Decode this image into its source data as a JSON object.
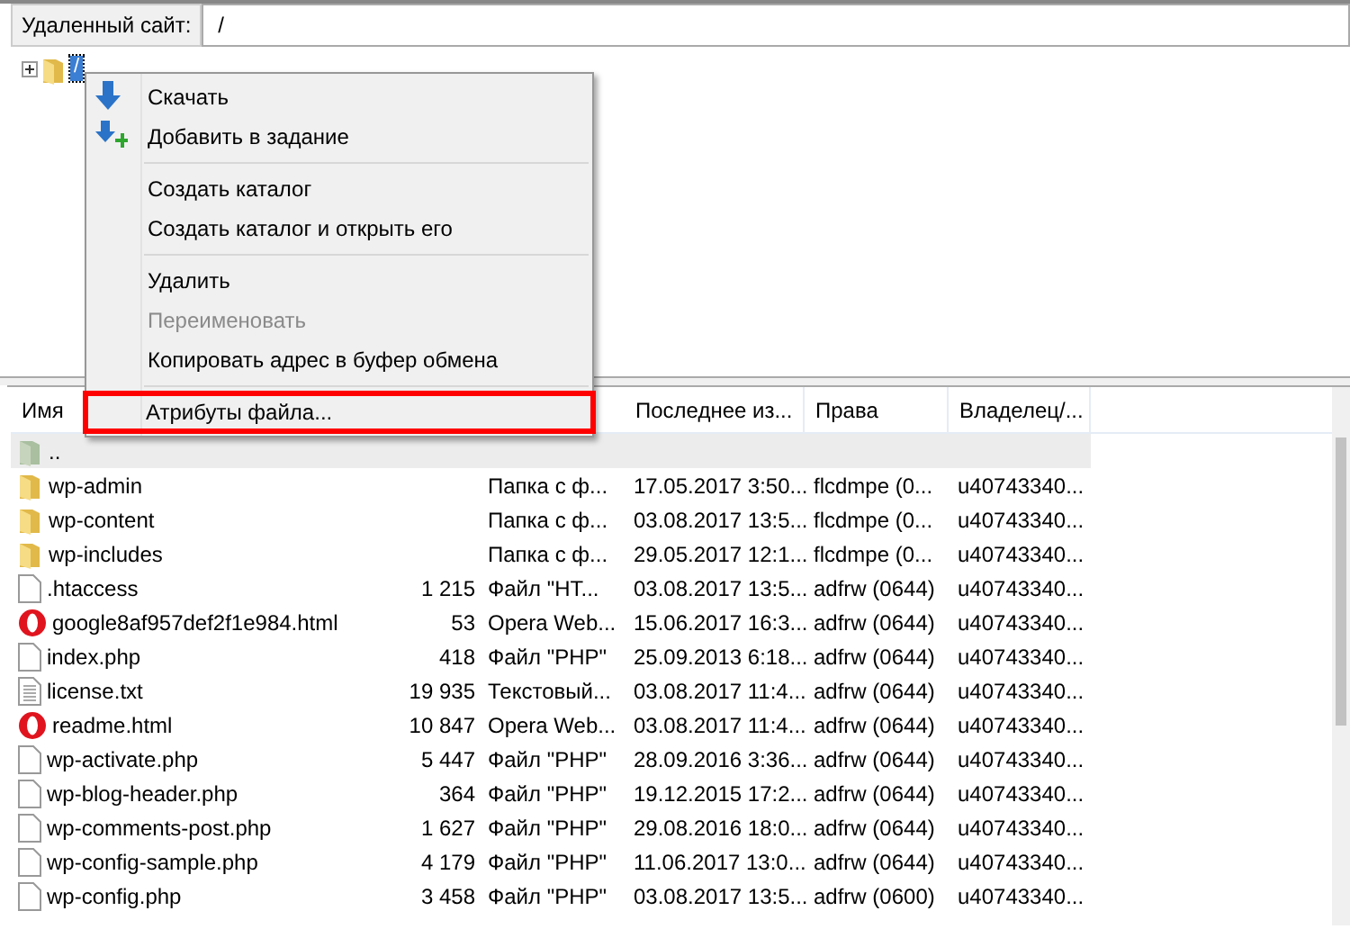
{
  "address_bar": {
    "label": "Удаленный сайт:",
    "value": "/"
  },
  "tree": {
    "root": {
      "label": "/",
      "expanded": false
    }
  },
  "context_menu": {
    "groups": [
      [
        {
          "label": "Скачать",
          "kind": "download",
          "disabled": false,
          "highlighted": false
        },
        {
          "label": "Добавить в задание",
          "kind": "queue",
          "disabled": false,
          "highlighted": false
        }
      ],
      [
        {
          "label": "Создать каталог",
          "disabled": false,
          "highlighted": false
        },
        {
          "label": "Создать каталог и открыть его",
          "disabled": false,
          "highlighted": false
        }
      ],
      [
        {
          "label": "Удалить",
          "disabled": false,
          "highlighted": false
        },
        {
          "label": "Переименовать",
          "disabled": true,
          "highlighted": false
        },
        {
          "label": "Копировать адрес в буфер обмена",
          "disabled": false,
          "highlighted": false
        }
      ],
      [
        {
          "label": "Атрибуты файла...",
          "disabled": false,
          "highlighted": true
        }
      ]
    ]
  },
  "file_list": {
    "columns": [
      "Имя",
      "",
      "",
      "Последнее из...",
      "Права",
      "Владелец/..."
    ],
    "rows": [
      {
        "kind": "parent",
        "name": "..",
        "size": "",
        "type": "",
        "modified": "",
        "rights": "",
        "owner": "",
        "selected": true
      },
      {
        "kind": "folder",
        "name": "wp-admin",
        "size": "",
        "type": "Папка с ф...",
        "modified": "17.05.2017 3:50...",
        "rights": "flcdmpe (0...",
        "owner": "u40743340...",
        "selected": false
      },
      {
        "kind": "folder",
        "name": "wp-content",
        "size": "",
        "type": "Папка с ф...",
        "modified": "03.08.2017 13:5...",
        "rights": "flcdmpe (0...",
        "owner": "u40743340...",
        "selected": false
      },
      {
        "kind": "folder",
        "name": "wp-includes",
        "size": "",
        "type": "Папка с ф...",
        "modified": "29.05.2017 12:1...",
        "rights": "flcdmpe (0...",
        "owner": "u40743340...",
        "selected": false
      },
      {
        "kind": "file",
        "name": ".htaccess",
        "size": "1 215",
        "type": "Файл \"HT...",
        "modified": "03.08.2017 13:5...",
        "rights": "adfrw (0644)",
        "owner": "u40743340...",
        "selected": false
      },
      {
        "kind": "opera",
        "name": "google8af957def2f1e984.html",
        "size": "53",
        "type": "Opera Web...",
        "modified": "15.06.2017 16:3...",
        "rights": "adfrw (0644)",
        "owner": "u40743340...",
        "selected": false
      },
      {
        "kind": "file",
        "name": "index.php",
        "size": "418",
        "type": "Файл \"PHP\"",
        "modified": "25.09.2013 6:18...",
        "rights": "adfrw (0644)",
        "owner": "u40743340...",
        "selected": false
      },
      {
        "kind": "text",
        "name": "license.txt",
        "size": "19 935",
        "type": "Текстовый...",
        "modified": "03.08.2017 11:4...",
        "rights": "adfrw (0644)",
        "owner": "u40743340...",
        "selected": false
      },
      {
        "kind": "opera",
        "name": "readme.html",
        "size": "10 847",
        "type": "Opera Web...",
        "modified": "03.08.2017 11:4...",
        "rights": "adfrw (0644)",
        "owner": "u40743340...",
        "selected": false
      },
      {
        "kind": "file",
        "name": "wp-activate.php",
        "size": "5 447",
        "type": "Файл \"PHP\"",
        "modified": "28.09.2016 3:36...",
        "rights": "adfrw (0644)",
        "owner": "u40743340...",
        "selected": false
      },
      {
        "kind": "file",
        "name": "wp-blog-header.php",
        "size": "364",
        "type": "Файл \"PHP\"",
        "modified": "19.12.2015 17:2...",
        "rights": "adfrw (0644)",
        "owner": "u40743340...",
        "selected": false
      },
      {
        "kind": "file",
        "name": "wp-comments-post.php",
        "size": "1 627",
        "type": "Файл \"PHP\"",
        "modified": "29.08.2016 18:0...",
        "rights": "adfrw (0644)",
        "owner": "u40743340...",
        "selected": false
      },
      {
        "kind": "file",
        "name": "wp-config-sample.php",
        "size": "4 179",
        "type": "Файл \"PHP\"",
        "modified": "11.06.2017 13:0...",
        "rights": "adfrw (0644)",
        "owner": "u40743340...",
        "selected": false
      },
      {
        "kind": "file",
        "name": "wp-config.php",
        "size": "3 458",
        "type": "Файл \"PHP\"",
        "modified": "03.08.2017 13:5...",
        "rights": "adfrw (0600)",
        "owner": "u40743340...",
        "selected": false
      }
    ]
  }
}
